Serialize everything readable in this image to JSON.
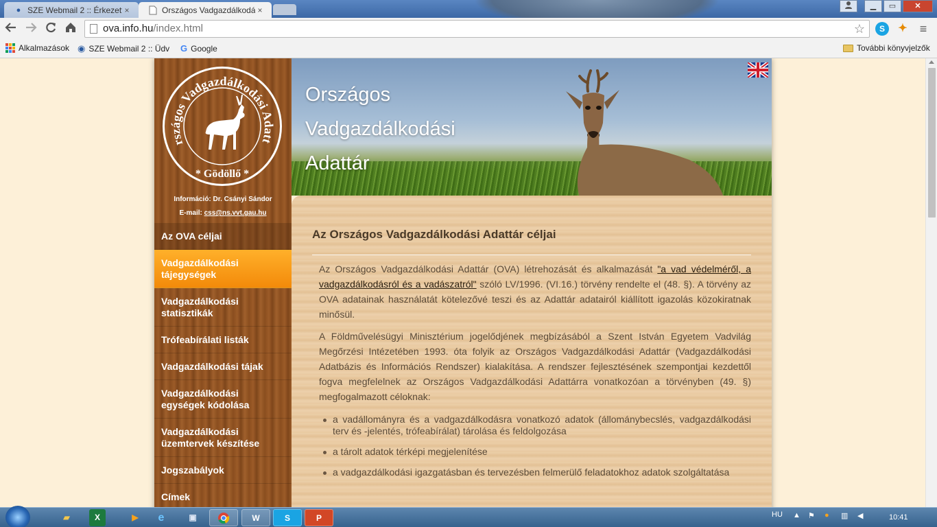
{
  "browser": {
    "tabs": [
      {
        "title": "SZE Webmail 2 :: Érkezett",
        "active": false
      },
      {
        "title": "Országos Vadgazdálkodás",
        "active": true
      }
    ],
    "close_glyph": "×",
    "url_host": "ova.info.hu",
    "url_path": "/index.html",
    "bookmarks": [
      {
        "label": "Alkalmazások",
        "icon": "apps-grid-icon"
      },
      {
        "label": "SZE Webmail 2 :: Üdv",
        "icon": "webmail-icon"
      },
      {
        "label": "Google",
        "icon": "google-icon"
      }
    ],
    "other_bookmarks": "További könyvjelzők"
  },
  "site": {
    "logo": {
      "arc_text": "Országos Vadgazdálkodási Adattár",
      "bottom_text": "Gödöllő"
    },
    "contact": {
      "info": "Információ: Dr. Csányi Sándor",
      "email_label": "E-mail:",
      "email": "css@ns.vvt.gau.hu"
    },
    "menu": [
      {
        "label": "Az OVA céljai",
        "state": "current"
      },
      {
        "label": "Vadgazdálkodási tájegységek",
        "state": "hover"
      },
      {
        "label": "Vadgazdálkodási statisztikák",
        "state": "normal"
      },
      {
        "label": "Trófeabírálati listák",
        "state": "normal"
      },
      {
        "label": "Vadgazdálkodási tájak",
        "state": "normal"
      },
      {
        "label": "Vadgazdálkodási egységek kódolása",
        "state": "normal"
      },
      {
        "label": "Vadgazdálkodási üzemtervek készítése",
        "state": "normal"
      },
      {
        "label": "Jogszabályok",
        "state": "normal"
      },
      {
        "label": "Címek",
        "state": "normal"
      }
    ],
    "header_title": [
      "Országos",
      "Vadgazdálkodási",
      "Adattár"
    ],
    "language_flag": "english-flag-icon"
  },
  "article": {
    "heading": "Az Országos Vadgazdálkodási Adattár céljai",
    "p1_before": "Az Országos Vadgazdálkodási Adattár (OVA) létrehozását és alkalmazását ",
    "p1_link": "\"a vad védelméről, a vadgazdálkodásról és a vadászatról\"",
    "p1_after": " szóló LV/1996. (VI.16.) törvény rendelte el (48. §). A törvény az OVA adatainak használatát kötelezővé teszi és az Adattár adatairól kiállított igazolás közokiratnak minősül.",
    "p2": "A Földművelésügyi Minisztérium jogelődjének megbízásából a Szent István Egyetem Vadvilág Megőrzési Intézetében 1993. óta folyik az Országos Vadgazdálkodási Adattár (Vadgazdálkodási Adatbázis és Információs Rendszer) kialakítása. A rendszer fejlesztésének szempontjai kezdettől fogva megfelelnek az Országos Vadgazdálkodási Adattárra vonatkozóan a törvényben (49. §) megfogalmazott céloknak:",
    "bullets": [
      "a vadállományra és a vadgazdálkodásra vonatkozó adatok (állománybecslés, vadgazdálkodási terv és -jelentés, trófeabírálat) tárolása és feldolgozása",
      "a tárolt adatok térképi megjelenítése",
      "a vadgazdálkodási igazgatásban és tervezésben felmerülő feladatokhoz adatok szolgáltatása"
    ]
  },
  "taskbar": {
    "apps": [
      "explorer-icon",
      "excel-icon",
      "media-player-icon",
      "internet-explorer-icon",
      "save-icon",
      "chrome-icon",
      "word-icon",
      "skype-icon",
      "powerpoint-icon"
    ],
    "language": "HU",
    "clock": "10:41"
  },
  "colors": {
    "menu_hover": "#f7921a",
    "title_bar": "#3c68a5",
    "page_background": "#fdf0d8"
  }
}
